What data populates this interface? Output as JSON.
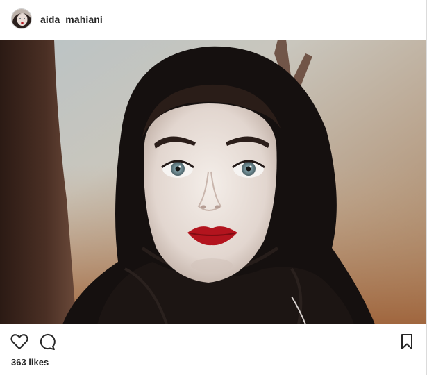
{
  "post": {
    "username": "aida_mahiani",
    "likes_text": "363 likes"
  },
  "icons": {
    "like": "heart-icon",
    "comment": "comment-bubble-icon",
    "save": "bookmark-icon"
  },
  "colors": {
    "text": "#262626",
    "divider": "#dbdbdb",
    "lipstick": "#b3141e",
    "scarf": "#15100f"
  }
}
